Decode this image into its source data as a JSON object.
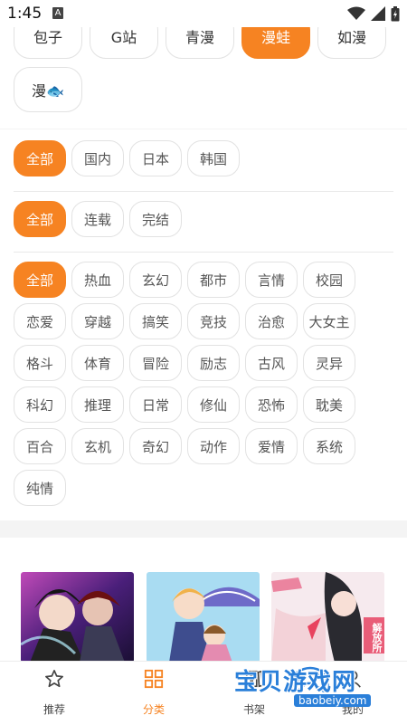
{
  "status_bar": {
    "time": "1:45",
    "notification_letter": "A"
  },
  "sources": [
    {
      "label": "包子",
      "active": false
    },
    {
      "label": "G站",
      "active": false
    },
    {
      "label": "青漫",
      "active": false
    },
    {
      "label": "漫蛙",
      "active": true
    },
    {
      "label": "如漫",
      "active": false
    },
    {
      "label": "漫🐟",
      "active": false
    }
  ],
  "regions": [
    {
      "label": "全部",
      "active": true
    },
    {
      "label": "国内",
      "active": false
    },
    {
      "label": "日本",
      "active": false
    },
    {
      "label": "韩国",
      "active": false
    }
  ],
  "status_filters": [
    {
      "label": "全部",
      "active": true
    },
    {
      "label": "连载",
      "active": false
    },
    {
      "label": "完结",
      "active": false
    }
  ],
  "genres": [
    {
      "label": "全部",
      "active": true
    },
    {
      "label": "热血"
    },
    {
      "label": "玄幻"
    },
    {
      "label": "都市"
    },
    {
      "label": "言情"
    },
    {
      "label": "校园"
    },
    {
      "label": "恋爱"
    },
    {
      "label": "穿越"
    },
    {
      "label": "搞笑"
    },
    {
      "label": "竞技"
    },
    {
      "label": "治愈"
    },
    {
      "label": "大女主"
    },
    {
      "label": "格斗"
    },
    {
      "label": "体育"
    },
    {
      "label": "冒险"
    },
    {
      "label": "励志"
    },
    {
      "label": "古风"
    },
    {
      "label": "灵异"
    },
    {
      "label": "科幻"
    },
    {
      "label": "推理"
    },
    {
      "label": "日常"
    },
    {
      "label": "修仙"
    },
    {
      "label": "恐怖"
    },
    {
      "label": "耽美"
    },
    {
      "label": "百合"
    },
    {
      "label": "玄机"
    },
    {
      "label": "奇幻"
    },
    {
      "label": "动作"
    },
    {
      "label": "爱情"
    },
    {
      "label": "系统"
    },
    {
      "label": "纯情"
    }
  ],
  "covers": [
    {
      "icon": "comic-cover-1",
      "colors": [
        "#3a1a5a",
        "#8a2fb4",
        "#d9a2ff"
      ]
    },
    {
      "icon": "comic-cover-2",
      "colors": [
        "#9fd6f0",
        "#f1c86b",
        "#6a78c9"
      ]
    },
    {
      "icon": "comic-cover-3",
      "colors": [
        "#f8e6ea",
        "#2b2b33",
        "#e85c78"
      ]
    }
  ],
  "cover3_badge": "解放所",
  "tabs": [
    {
      "label": "推荐",
      "icon": "star-icon",
      "active": false
    },
    {
      "label": "分类",
      "icon": "grid-icon",
      "active": true
    },
    {
      "label": "书架",
      "icon": "bookshelf-icon",
      "active": false
    },
    {
      "label": "我的",
      "icon": "user-icon",
      "active": false
    }
  ],
  "watermark": {
    "title": "宝贝游戏网",
    "url": "baobeiy.com"
  },
  "colors": {
    "accent": "#f68322",
    "chip_border": "#e2e2e2",
    "background": "#f4f4f4"
  }
}
